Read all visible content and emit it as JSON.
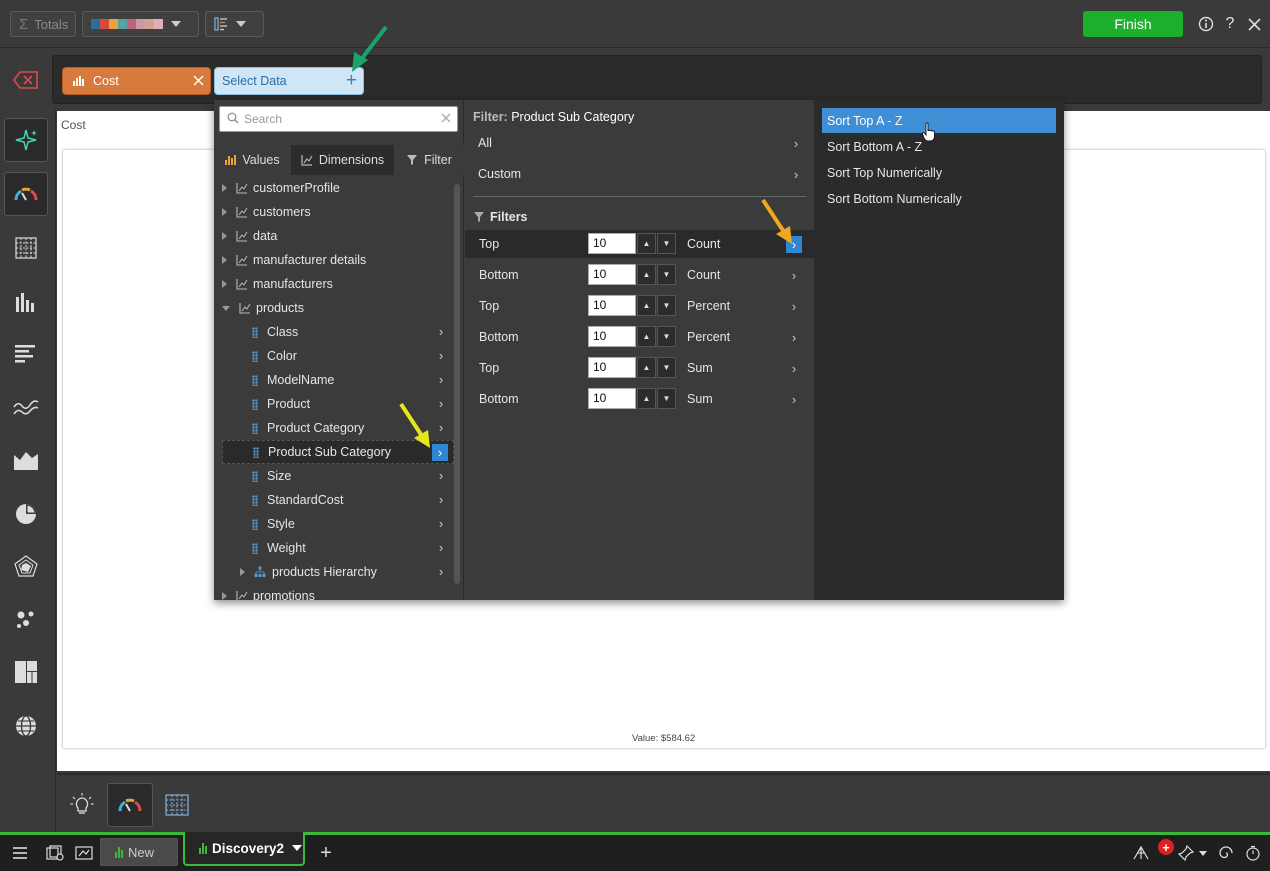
{
  "toolbar": {
    "totals_label": "Totals",
    "finish_label": "Finish",
    "palette_colors": [
      "#2b6e9c",
      "#d74b3a",
      "#e8a33c",
      "#5aa0a0",
      "#b8657a",
      "#c99aa5",
      "#d8a090",
      "#e0b0b8"
    ]
  },
  "databar": {
    "cost_label": "Cost",
    "select_label": "Select Data"
  },
  "dropdown": {
    "search_placeholder": "Search",
    "tabs": {
      "values": "Values",
      "dimensions": "Dimensions",
      "filter": "Filter"
    },
    "tree": [
      {
        "label": "customerProfile"
      },
      {
        "label": "customers"
      },
      {
        "label": "data"
      },
      {
        "label": "manufacturer details"
      },
      {
        "label": "manufacturers"
      },
      {
        "label": "products"
      },
      {
        "label": "Class"
      },
      {
        "label": "Color"
      },
      {
        "label": "ModelName"
      },
      {
        "label": "Product"
      },
      {
        "label": "Product Category"
      },
      {
        "label": "Product Sub Category"
      },
      {
        "label": "Size"
      },
      {
        "label": "StandardCost"
      },
      {
        "label": "Style"
      },
      {
        "label": "Weight"
      },
      {
        "label": "products Hierarchy"
      },
      {
        "label": "promotions"
      }
    ],
    "filter_prefix": "Filter:",
    "filter_target": "Product Sub Category",
    "all_label": "All",
    "custom_label": "Custom",
    "filters_heading": "Filters",
    "filter_rows": [
      {
        "pos": "Top",
        "n": "10",
        "type": "Count"
      },
      {
        "pos": "Bottom",
        "n": "10",
        "type": "Count"
      },
      {
        "pos": "Top",
        "n": "10",
        "type": "Percent"
      },
      {
        "pos": "Bottom",
        "n": "10",
        "type": "Percent"
      },
      {
        "pos": "Top",
        "n": "10",
        "type": "Sum"
      },
      {
        "pos": "Bottom",
        "n": "10",
        "type": "Sum"
      }
    ],
    "sort_options": [
      "Sort Top A - Z",
      "Sort Bottom A - Z",
      "Sort Top Numerically",
      "Sort Bottom Numerically"
    ]
  },
  "canvas": {
    "title": "Cost",
    "value_label": "Value: $584.62"
  },
  "statusbar": {
    "tab_new": "New",
    "tab_active": "Discovery2"
  }
}
